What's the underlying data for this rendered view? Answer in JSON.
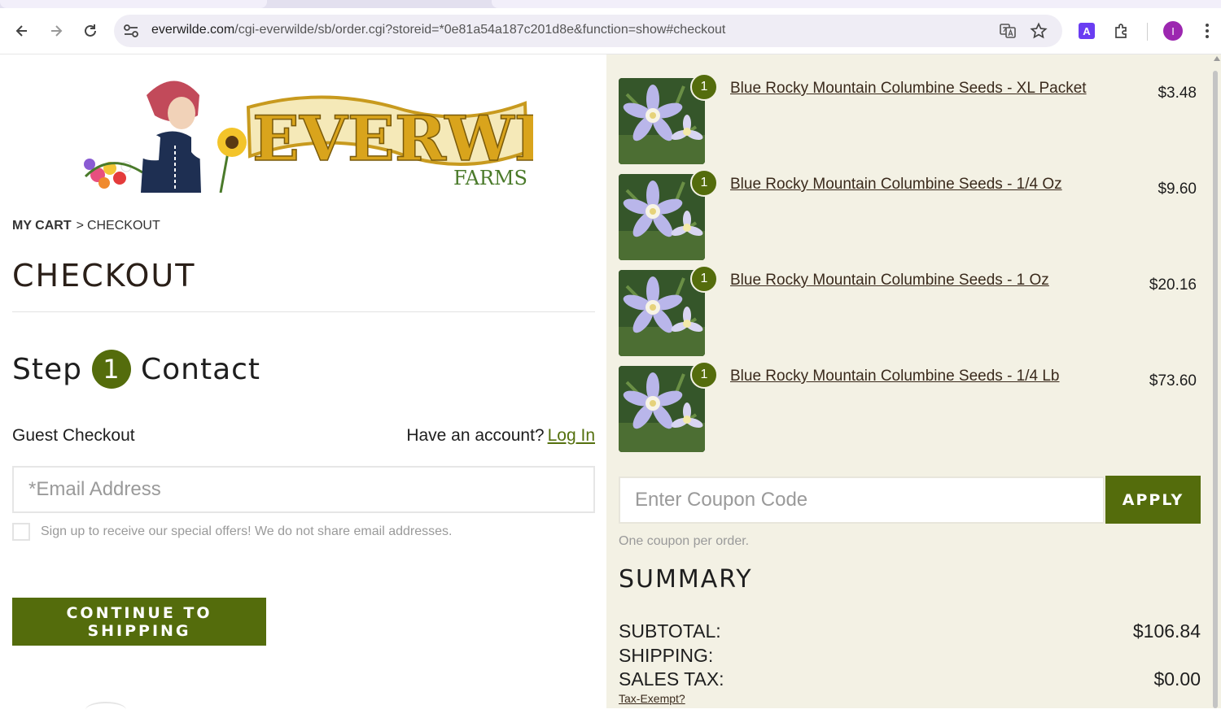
{
  "browser": {
    "url_host": "everwilde.com",
    "url_path": "/cgi-everwilde/sb/order.cgi?storeid=*0e81a54a187c201d8e&function=show#checkout",
    "extension_letter": "A",
    "profile_initial": "I"
  },
  "logo": {
    "brand": "EVERWILDE",
    "sub": "FARMS"
  },
  "breadcrumb": {
    "cart": "MY CART",
    "separator": ">",
    "current": "CHECKOUT"
  },
  "page_title": "CHECKOUT",
  "step": {
    "prefix": "Step",
    "number": "1",
    "label": "Contact"
  },
  "guest_label": "Guest Checkout",
  "account": {
    "prompt": "Have an account?",
    "login_link": "Log In"
  },
  "email_placeholder": "*Email Address",
  "optin_text": "Sign up to receive our special offers! We do not share email addresses.",
  "continue_button": "CONTINUE TO SHIPPING",
  "cart_items": [
    {
      "qty": "1",
      "name": "Blue Rocky Mountain Columbine Seeds - XL Packet",
      "price": "$3.48"
    },
    {
      "qty": "1",
      "name": "Blue Rocky Mountain Columbine Seeds - 1/4 Oz",
      "price": "$9.60"
    },
    {
      "qty": "1",
      "name": "Blue Rocky Mountain Columbine Seeds - 1 Oz",
      "price": "$20.16"
    },
    {
      "qty": "1",
      "name": "Blue Rocky Mountain Columbine Seeds - 1/4 Lb",
      "price": "$73.60"
    }
  ],
  "coupon": {
    "placeholder": "Enter Coupon Code",
    "apply_button": "APPLY",
    "note": "One coupon per order."
  },
  "summary": {
    "title": "SUMMARY",
    "subtotal_label": "SUBTOTAL:",
    "subtotal_value": "$106.84",
    "shipping_label": "SHIPPING:",
    "shipping_value": "",
    "tax_label": "SALES TAX:",
    "tax_value": "$0.00",
    "tax_exempt_link": "Tax-Exempt?"
  },
  "colors": {
    "accent_green": "#546c0c",
    "sidebar_bg": "#f3f1e4"
  }
}
